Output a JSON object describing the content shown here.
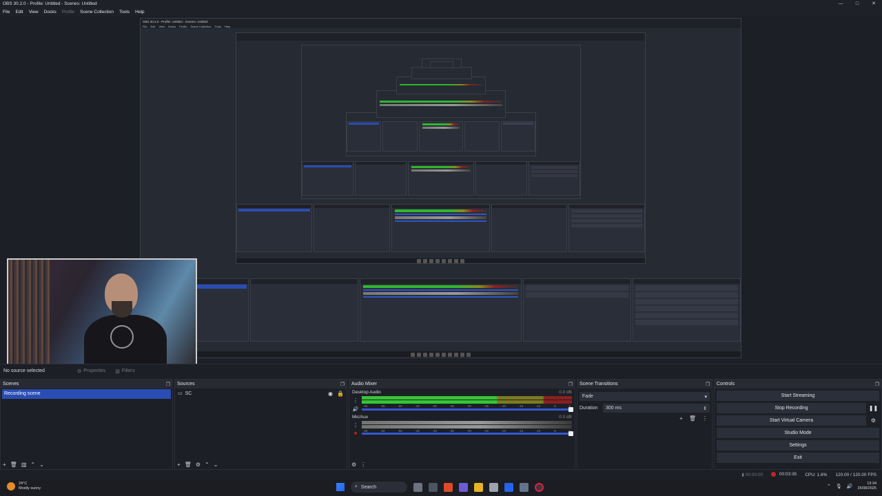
{
  "window": {
    "title": "OBS 30.2.0 - Profile: Untitled - Scenes: Untitled",
    "controls": [
      "—",
      "□",
      "✕"
    ]
  },
  "menu": [
    "File",
    "Edit",
    "View",
    "Docks",
    "Profile",
    "Scene Collection",
    "Tools",
    "Help"
  ],
  "source_toolbar": {
    "no_source": "No source selected",
    "properties": "Properties",
    "filters": "Filters"
  },
  "scenes": {
    "title": "Scenes",
    "items": [
      "Recording scene"
    ]
  },
  "sources": {
    "title": "Sources",
    "items": [
      "SC"
    ]
  },
  "audio_mixer": {
    "title": "Audio Mixer",
    "ticks": [
      "-60",
      "-55",
      "-50",
      "-45",
      "-40",
      "-35",
      "-30",
      "-25",
      "-20",
      "-15",
      "-10",
      "-5",
      "0"
    ],
    "channels": [
      {
        "name": "Desktop Audio",
        "db": "0.0 dB"
      },
      {
        "name": "Mic/Aux",
        "db": "0.0 dB"
      }
    ]
  },
  "transitions": {
    "title": "Scene Transitions",
    "selected": "Fade",
    "duration_label": "Duration",
    "duration_value": "300 ms"
  },
  "controls": {
    "title": "Controls",
    "start_streaming": "Start Streaming",
    "stop_recording": "Stop Recording",
    "start_virtual_camera": "Start Virtual Camera",
    "studio_mode": "Studio Mode",
    "settings": "Settings",
    "exit": "Exit"
  },
  "status": {
    "stream_time": "00:00:00",
    "rec_time": "00:03:35",
    "cpu": "CPU: 1.6%",
    "fps": "120.00 / 120.00 FPS"
  },
  "taskbar": {
    "temp": "24°C",
    "weather": "Mostly sunny",
    "search": "Search",
    "time": "13:34",
    "date": "25/08/2025"
  },
  "preview_nested": {
    "nested_title": "OBS 30.2.0 - Profile: Untitled - Scenes: Untitled",
    "nested_menu": [
      "File",
      "Edit",
      "View",
      "Docks",
      "Profile",
      "Scene Collection",
      "Tools",
      "Help"
    ]
  },
  "colors": {
    "accent": "#2a4db3",
    "record": "#cc2222",
    "meter_green": "#37c437"
  }
}
